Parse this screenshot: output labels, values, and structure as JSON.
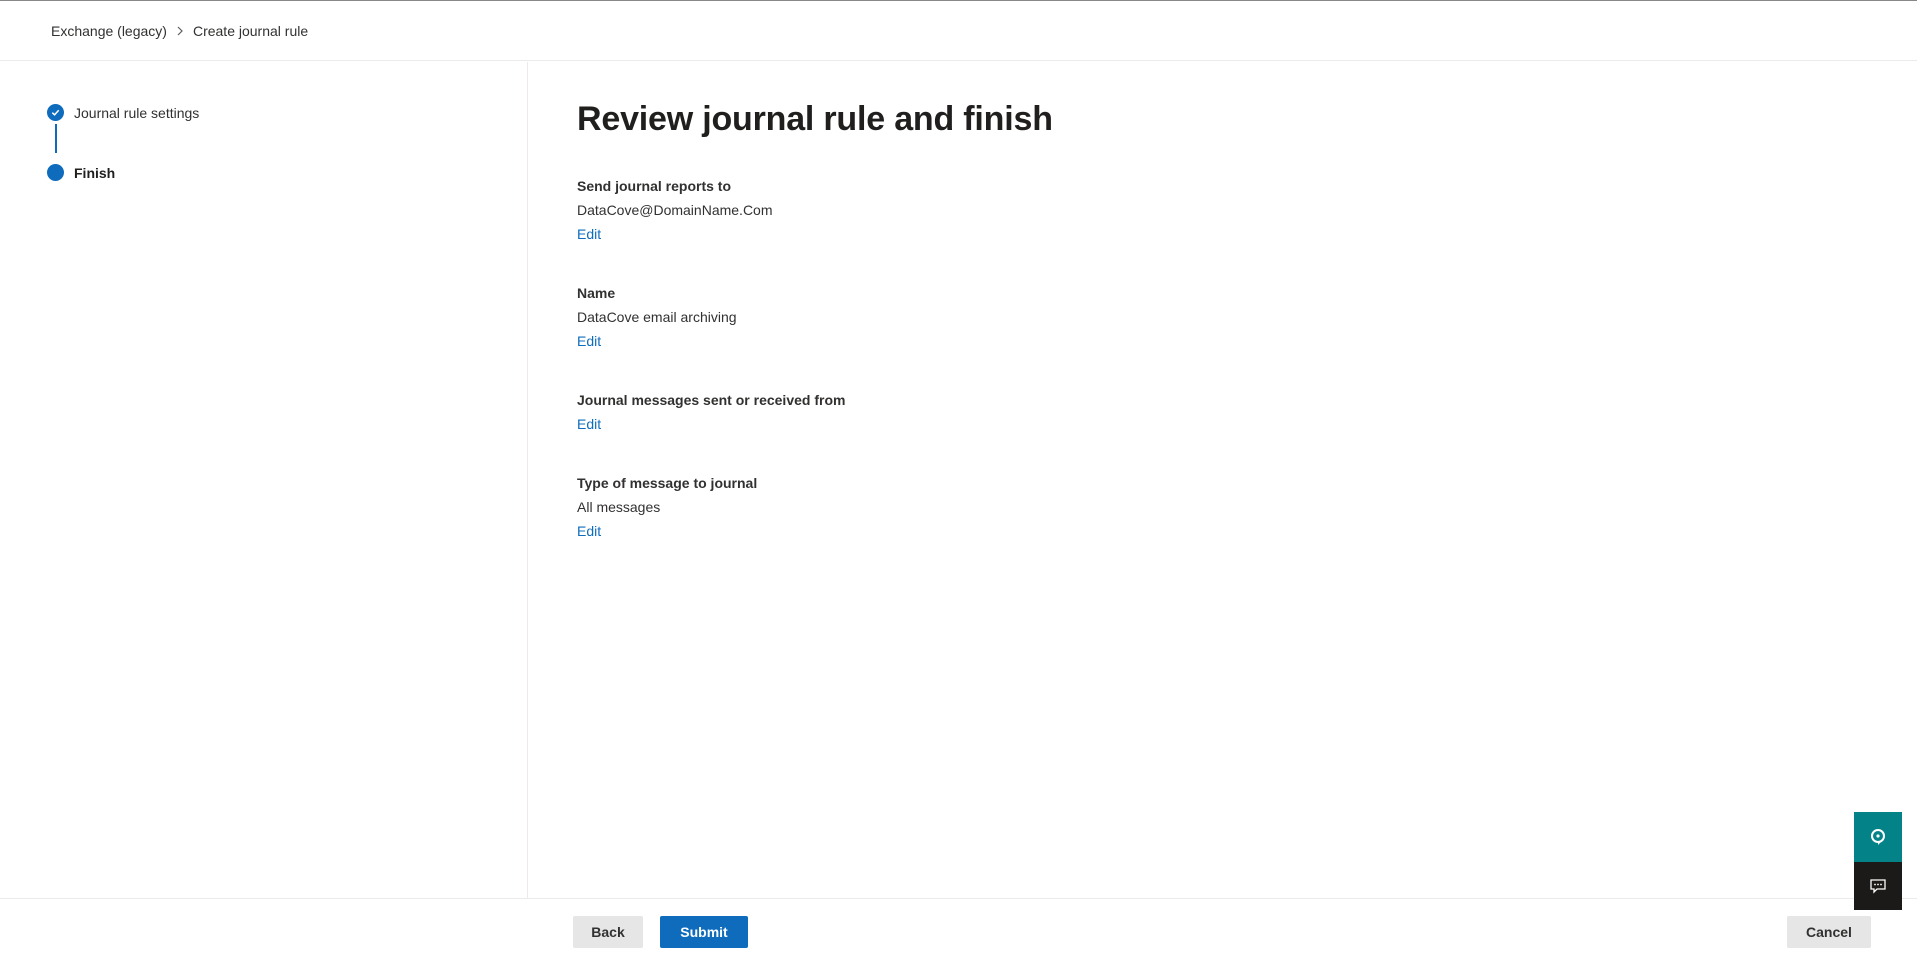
{
  "breadcrumb": {
    "items": [
      "Exchange (legacy)",
      "Create journal rule"
    ]
  },
  "steps": [
    {
      "label": "Journal rule settings",
      "state": "completed"
    },
    {
      "label": "Finish",
      "state": "current"
    }
  ],
  "main": {
    "title": "Review journal rule and finish",
    "sections": [
      {
        "label": "Send journal reports to",
        "value": "DataCove@DomainName.Com",
        "edit": "Edit"
      },
      {
        "label": "Name",
        "value": "DataCove email archiving",
        "edit": "Edit"
      },
      {
        "label": "Journal messages sent or received from",
        "value": "",
        "edit": "Edit"
      },
      {
        "label": "Type of message to journal",
        "value": "All messages",
        "edit": "Edit"
      }
    ]
  },
  "footer": {
    "back_label": "Back",
    "submit_label": "Submit",
    "cancel_label": "Cancel"
  },
  "floating": {
    "help_icon": "help-icon",
    "feedback_icon": "feedback-icon"
  },
  "colors": {
    "accent": "#0f6cbd",
    "help_bg": "#038387",
    "feedback_bg": "#1b1a19"
  }
}
